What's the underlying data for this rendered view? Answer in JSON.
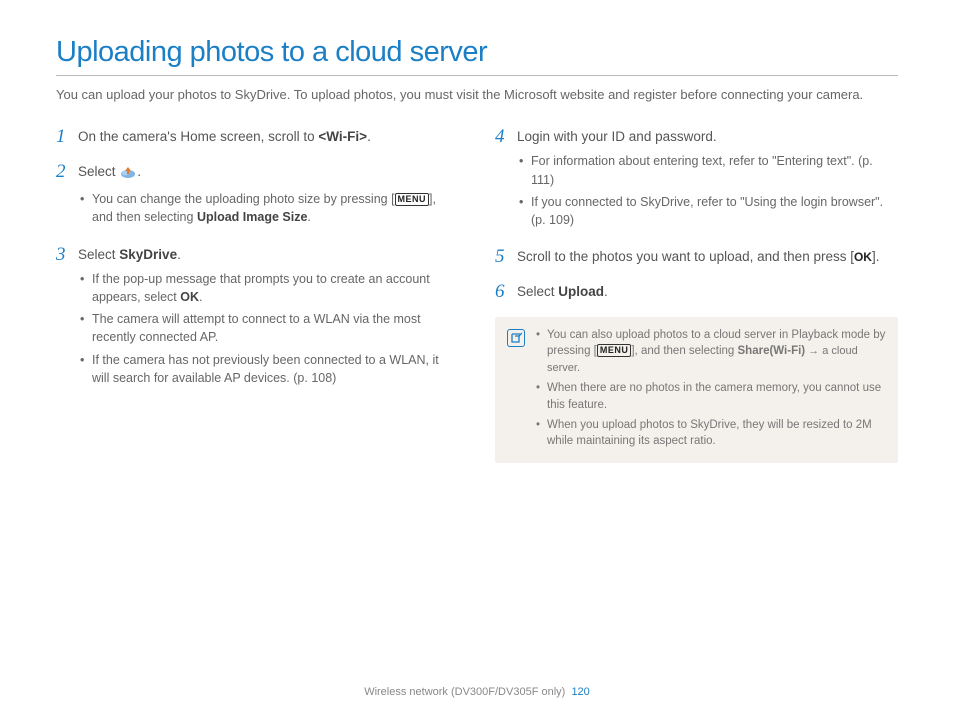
{
  "title": "Uploading photos to a cloud server",
  "intro": "You can upload your photos to SkyDrive. To upload photos, you must visit the Microsoft website and register before connecting your camera.",
  "steps": {
    "s1": {
      "num": "1",
      "text_a": "On the camera's Home screen, scroll to ",
      "text_b": "<Wi-Fi>",
      "text_c": "."
    },
    "s2": {
      "num": "2",
      "text_a": "Select ",
      "text_b": ".",
      "sub1_a": "You can change the uploading photo size by pressing [",
      "sub1_b": "], and then selecting ",
      "sub1_c": "Upload Image Size",
      "sub1_d": "."
    },
    "s3": {
      "num": "3",
      "text_a": "Select ",
      "text_b": "SkyDrive",
      "text_c": ".",
      "sub1_a": "If the pop-up message that prompts you to create an account appears, select ",
      "sub1_b": "OK",
      "sub1_c": ".",
      "sub2": "The camera will attempt to connect to a WLAN via the most recently connected AP.",
      "sub3": "If the camera has not previously been connected to a WLAN, it will search for available AP devices. (p. 108)"
    },
    "s4": {
      "num": "4",
      "text": "Login with your ID and password.",
      "sub1": "For information about entering text, refer to \"Entering text\". (p. 111)",
      "sub2": "If you connected to SkyDrive, refer to \"Using the login browser\". (p. 109)"
    },
    "s5": {
      "num": "5",
      "text_a": "Scroll to the photos you want to upload, and then press [",
      "text_b": "]."
    },
    "s6": {
      "num": "6",
      "text_a": "Select ",
      "text_b": "Upload",
      "text_c": "."
    }
  },
  "labels": {
    "menu": "MENU",
    "ok": "OK"
  },
  "note": {
    "n1_a": "You can also upload photos to a cloud server in Playback mode by pressing [",
    "n1_b": "], and then selecting ",
    "n1_c": "Share(Wi-Fi)",
    "n1_d": " → a cloud server.",
    "n2": "When there are no photos in the camera memory, you cannot use this feature.",
    "n3": "When you upload photos to SkyDrive, they will be resized to 2M while maintaining its aspect ratio."
  },
  "footer": {
    "section": "Wireless network (DV300F/DV305F only)",
    "page": "120"
  }
}
